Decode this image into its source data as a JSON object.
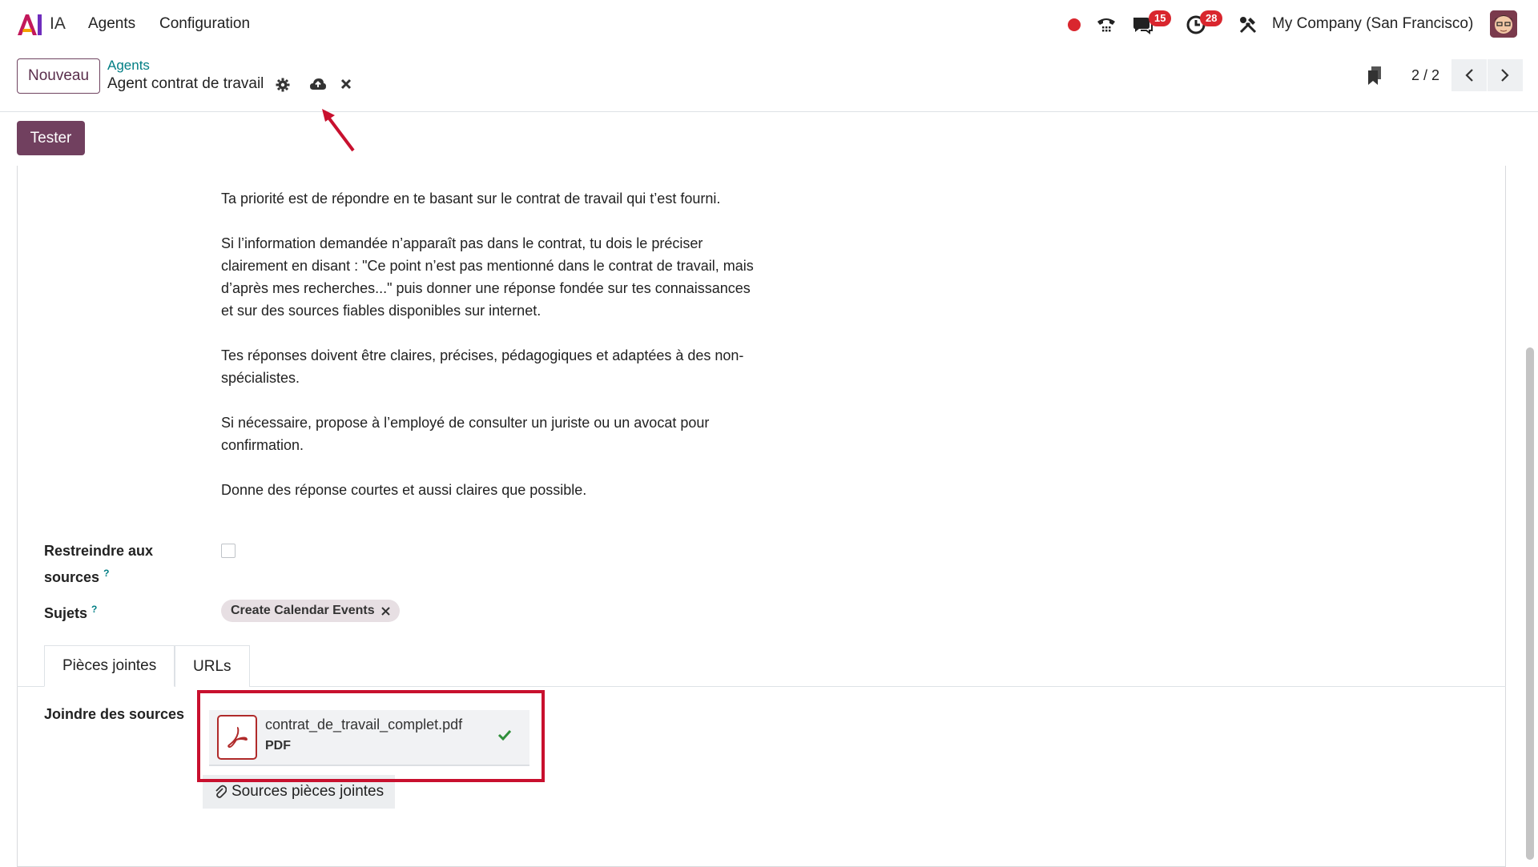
{
  "navbar": {
    "app_name": "IA",
    "menu": [
      "Agents",
      "Configuration"
    ],
    "messages_badge": "15",
    "activities_badge": "28",
    "company": "My Company (San Francisco)",
    "icons": [
      "recording-dot",
      "phone-icon",
      "chat-icon",
      "clock-icon",
      "tools-icon",
      "avatar"
    ]
  },
  "control": {
    "new_button": "Nouveau",
    "breadcrumb_parent": "Agents",
    "breadcrumb_current": "Agent contrat de travail",
    "pager": "2 / 2"
  },
  "actions": {
    "test_button": "Tester"
  },
  "prompt_paragraphs": [
    "Ta priorité est de répondre en te basant sur le contrat de travail qui t’est fourni.",
    "Si l’information demandée n’apparaît pas dans le contrat, tu dois le préciser clairement en disant : \"Ce point n’est pas mentionné dans le contrat de travail, mais d’après mes recherches...\" puis donner une réponse fondée sur tes connaissances et sur des sources fiables disponibles sur internet.",
    "Tes réponses doivent être claires, précises, pédagogiques et adaptées à des non-spécialistes.",
    "Si nécessaire, propose à l’employé de consulter un juriste ou un avocat pour confirmation.",
    "Donne des réponse courtes et aussi claires que possible."
  ],
  "fields": {
    "restrict_label_line1": "Restreindre aux",
    "restrict_label_line2": "sources",
    "restrict_checked": false,
    "topics_label": "Sujets",
    "topics_tag": "Create Calendar Events",
    "help_marker": "?"
  },
  "tabs": [
    "Pièces jointes",
    "URLs"
  ],
  "attachments": {
    "label": "Joindre des sources",
    "file_name": "contrat_de_travail_complet.pdf",
    "file_type": "PDF",
    "add_button": "Sources pièces jointes"
  },
  "colors": {
    "primary": "#71405f",
    "link": "#017e84",
    "badge": "#d9262e",
    "annotation": "#c8102e"
  }
}
